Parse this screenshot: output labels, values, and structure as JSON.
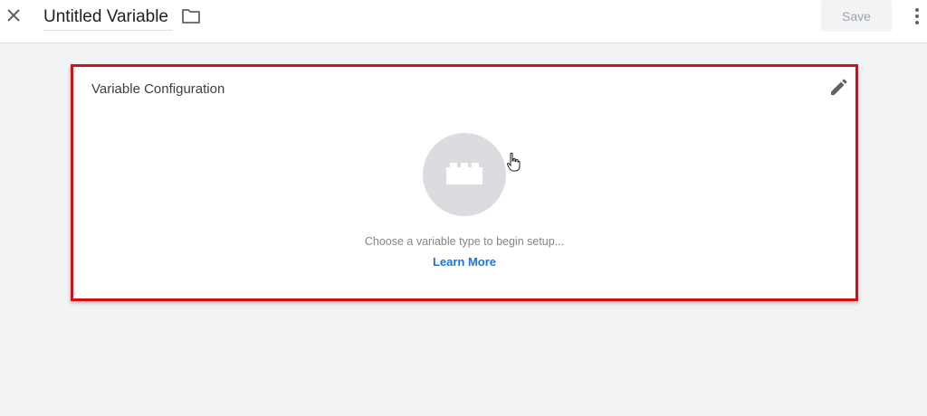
{
  "header": {
    "title": "Untitled Variable",
    "save_label": "Save",
    "icons": [
      "close-icon",
      "folder-icon",
      "more-vert-icon"
    ]
  },
  "card": {
    "title": "Variable Configuration",
    "hint": "Choose a variable type to begin setup...",
    "link": "Learn More",
    "icons": [
      "edit-icon",
      "building-block-icon"
    ],
    "highlight_color": "#d50f17"
  },
  "colors": {
    "link": "#1a73e8",
    "background": "#f1f3f4"
  }
}
